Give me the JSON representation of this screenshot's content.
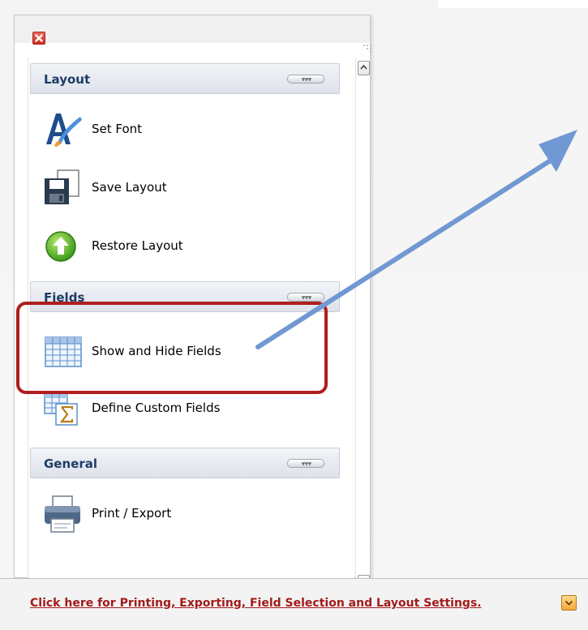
{
  "panel": {
    "close_glyph": "✕",
    "grip_icon": "resize-grip-icon",
    "scroll_up_glyph": "^",
    "scroll_down_glyph": "v"
  },
  "groups": [
    {
      "title": "Layout",
      "toggle_glyph": "ʏʏʏ",
      "items": [
        {
          "label": "Set Font",
          "icon": "font-icon"
        },
        {
          "label": "Save Layout",
          "icon": "save-layout-icon"
        },
        {
          "label": "Restore Layout",
          "icon": "restore-layout-icon"
        }
      ]
    },
    {
      "title": "Fields",
      "toggle_glyph": "ʏʏʏ",
      "items": [
        {
          "label": "Show and Hide Fields",
          "icon": "grid-table-icon"
        },
        {
          "label": "Define Custom Fields",
          "icon": "custom-fields-sigma-icon"
        }
      ]
    },
    {
      "title": "General",
      "toggle_glyph": "ʏʏʏ",
      "items": [
        {
          "label": "Print / Export",
          "icon": "printer-icon"
        }
      ]
    }
  ],
  "bottom_bar": {
    "link_text": "Click here for Printing, Exporting, Field Selection and Layout Settings.",
    "toggle_glyph": "v"
  },
  "colors": {
    "highlight": "#b01d1d",
    "arrow": "#6f93cf",
    "link": "#a21b1b",
    "group_title": "#1e3c64"
  }
}
